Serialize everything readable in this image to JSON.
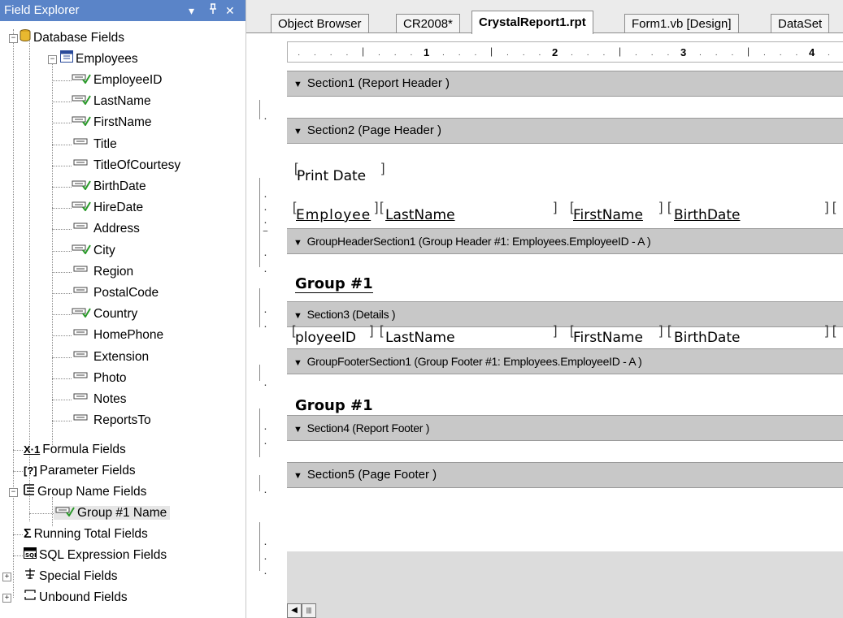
{
  "explorer": {
    "title": "Field Explorer",
    "controls": {
      "dropdown": "▾",
      "pin": "ᵖ",
      "close": "✕"
    },
    "tree": {
      "database_fields": "Database Fields",
      "table": "Employees",
      "fields": [
        {
          "label": "EmployeeID",
          "used": true
        },
        {
          "label": "LastName",
          "used": true
        },
        {
          "label": "FirstName",
          "used": true
        },
        {
          "label": "Title",
          "used": false
        },
        {
          "label": "TitleOfCourtesy",
          "used": false
        },
        {
          "label": "BirthDate",
          "used": true
        },
        {
          "label": "HireDate",
          "used": true
        },
        {
          "label": "Address",
          "used": false
        },
        {
          "label": "City",
          "used": true
        },
        {
          "label": "Region",
          "used": false
        },
        {
          "label": "PostalCode",
          "used": false
        },
        {
          "label": "Country",
          "used": true
        },
        {
          "label": "HomePhone",
          "used": false
        },
        {
          "label": "Extension",
          "used": false
        },
        {
          "label": "Photo",
          "used": false
        },
        {
          "label": "Notes",
          "used": false
        },
        {
          "label": "ReportsTo",
          "used": false
        }
      ],
      "formula_fields": "Formula Fields",
      "parameter_fields": "Parameter Fields",
      "group_name_fields": "Group Name Fields",
      "group_name_item": "Group #1 Name",
      "running_total_fields": "Running Total Fields",
      "sql_expression_fields": "SQL Expression Fields",
      "special_fields": "Special Fields",
      "unbound_fields": "Unbound Fields"
    }
  },
  "tabs": [
    {
      "label": "Object Browser",
      "active": false
    },
    {
      "label": "CR2008*",
      "active": false
    },
    {
      "label": "CrystalReport1.rpt",
      "active": true
    },
    {
      "label": "Form1.vb [Design]",
      "active": false
    },
    {
      "label": "DataSet",
      "active": false
    }
  ],
  "ruler": {
    "numbers": [
      "1",
      "2",
      "3",
      "4"
    ]
  },
  "sections": [
    {
      "label": "Section1 (Report Header )"
    },
    {
      "label": "Section2 (Page Header )"
    },
    {
      "label": "GroupHeaderSection1 (Group Header #1: Employees.EmployeeID - A )"
    },
    {
      "label": "Section3 (Details )"
    },
    {
      "label": "GroupFooterSection1 (Group Footer #1: Employees.EmployeeID - A )"
    },
    {
      "label": "Section4 (Report Footer )"
    },
    {
      "label": "Section5 (Page Footer )"
    }
  ],
  "report_objects": {
    "print_date": "Print Date",
    "header_employee": "Employee",
    "header_lastname": "LastName",
    "header_firstname": "FirstName",
    "header_birthdate": "BirthDate",
    "group_header_name": "Group #1",
    "detail_employeeid": "ployeeID",
    "detail_lastname": "LastName",
    "detail_firstname": "FirstName",
    "detail_birthdate": "BirthDate",
    "group_footer_name": "Group #1"
  },
  "scroll": {
    "left": "◀",
    "grip": "|||"
  }
}
